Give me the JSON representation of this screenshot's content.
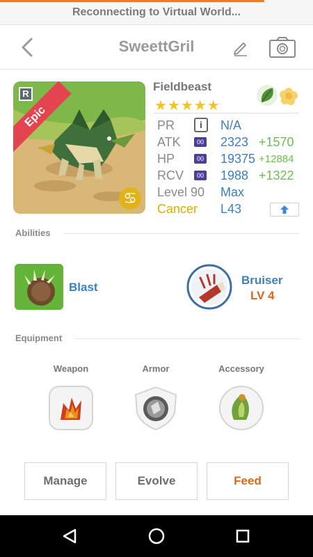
{
  "status": {
    "message": "Reconnecting to Virtual World..."
  },
  "header": {
    "title": "SweettGril"
  },
  "monster": {
    "name": "Fieldbeast",
    "rarity_badge": "R",
    "rarity": "Epic",
    "stars": "★★★★★",
    "star_count": 5,
    "elements": [
      "leaf-icon",
      "flower-icon"
    ],
    "stats": {
      "pr": {
        "label": "PR",
        "value": "N/A"
      },
      "atk": {
        "label": "ATK",
        "badge": "00",
        "value": "2323",
        "bonus": "+1570"
      },
      "hp": {
        "label": "HP",
        "badge": "00",
        "value": "19375",
        "bonus": "+12884"
      },
      "rcv": {
        "label": "RCV",
        "badge": "00",
        "value": "1988",
        "bonus": "+1322"
      },
      "level": {
        "label": "Level 90",
        "value": "Max"
      },
      "zodiac": {
        "label": "Cancer",
        "value": "L43"
      }
    }
  },
  "abilities": {
    "title": "Abilities",
    "ability": {
      "name": "Blast"
    },
    "skill": {
      "name": "Bruiser",
      "level": "LV 4"
    }
  },
  "equipment": {
    "title": "Equipment",
    "slots": [
      {
        "label": "Weapon"
      },
      {
        "label": "Armor"
      },
      {
        "label": "Accessory"
      }
    ]
  },
  "actions": {
    "manage": "Manage",
    "evolve": "Evolve",
    "feed": "Feed"
  },
  "colors": {
    "accent": "#f07a2c",
    "value_blue": "#3c7fc2",
    "bonus_green": "#6bc04b",
    "feed_orange": "#e06518",
    "star_gold": "#f5c518",
    "epic_red": "#e4444f"
  }
}
